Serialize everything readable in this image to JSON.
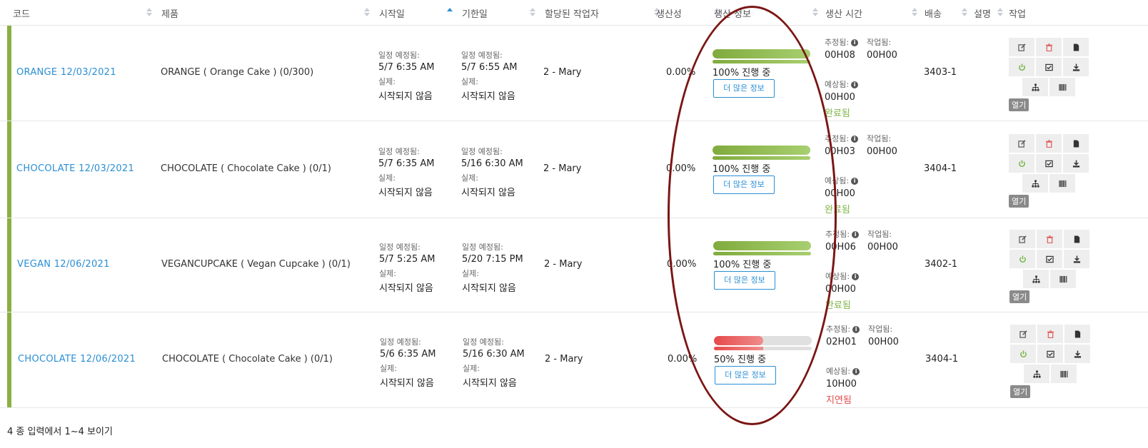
{
  "columns": [
    {
      "key": "code",
      "label": "코드"
    },
    {
      "key": "product",
      "label": "제품"
    },
    {
      "key": "start",
      "label": "시작일"
    },
    {
      "key": "due",
      "label": "기한일"
    },
    {
      "key": "assignee",
      "label": "할당된 작업자"
    },
    {
      "key": "productivity",
      "label": "생산성"
    },
    {
      "key": "prod_info",
      "label": "생산 정보"
    },
    {
      "key": "prod_time",
      "label": "생산 시간"
    },
    {
      "key": "shipping",
      "label": "배송"
    },
    {
      "key": "desc",
      "label": "설명"
    },
    {
      "key": "actions",
      "label": "작업"
    }
  ],
  "labels": {
    "scheduled": "일정 예정됨:",
    "actual": "실제:",
    "not_started": "시작되지 않음",
    "estimated": "추정됨:",
    "worked": "작업됨:",
    "expected": "예상됨:",
    "more_info": "더 많은 정보",
    "open": "열기",
    "info_glyph": "i"
  },
  "rows": [
    {
      "code": "ORANGE 12/03/2021",
      "product": "ORANGE ( Orange Cake ) (0/300)",
      "start_sched": "5/7   6:35 AM",
      "due_sched": "5/7   6:55 AM",
      "assignee": "2 - Mary",
      "productivity": "0.00%",
      "progress": 1.0,
      "progress_text": "100% 진행 중",
      "bar_color": "green",
      "estimated": "00H08",
      "worked": "00H00",
      "expected": "00H00",
      "status": "완료됨",
      "status_color": "green",
      "shipping": "3403-1"
    },
    {
      "code": "CHOCOLATE 12/03/2021",
      "product": "CHOCOLATE ( Chocolate Cake ) (0/1)",
      "start_sched": "5/7   6:35 AM",
      "due_sched": "5/16   6:30 AM",
      "assignee": "2 - Mary",
      "productivity": "0.00%",
      "progress": 1.0,
      "progress_text": "100% 진행 중",
      "bar_color": "green",
      "estimated": "00H03",
      "worked": "00H00",
      "expected": "00H00",
      "status": "완료됨",
      "status_color": "green",
      "shipping": "3404-1"
    },
    {
      "code": "VEGAN 12/06/2021",
      "product": "VEGANCUPCAKE ( Vegan Cupcake ) (0/1)",
      "start_sched": "5/7   5:25 AM",
      "due_sched": "5/20   7:15 PM",
      "assignee": "2 - Mary",
      "productivity": "0.00%",
      "progress": 1.0,
      "progress_text": "100% 진행 중",
      "bar_color": "green",
      "estimated": "00H06",
      "worked": "00H00",
      "expected": "00H00",
      "status": "완료됨",
      "status_color": "green",
      "shipping": "3402-1"
    },
    {
      "code": "CHOCOLATE 12/06/2021",
      "product": "CHOCOLATE ( Chocolate Cake ) (0/1)",
      "start_sched": "5/6   6:35 AM",
      "due_sched": "5/16   6:30 AM",
      "assignee": "2 - Mary",
      "productivity": "0.00%",
      "progress": 0.5,
      "progress_text": "50% 진행 중",
      "bar_color": "red",
      "estimated": "02H01",
      "worked": "00H00",
      "expected": "10H00",
      "status": "지연됨",
      "status_color": "red",
      "shipping": "3404-1"
    }
  ],
  "action_icons": [
    {
      "name": "edit-icon",
      "color": "#555"
    },
    {
      "name": "trash-icon",
      "color": "#e05a5a"
    },
    {
      "name": "document-icon",
      "color": "#333"
    },
    {
      "name": "power-icon",
      "color": "#6bb33a"
    },
    {
      "name": "checklist-icon",
      "color": "#333"
    },
    {
      "name": "download-icon",
      "color": "#333"
    },
    {
      "name": "hierarchy-icon",
      "color": "#333"
    },
    {
      "name": "barcode-icon",
      "color": "#333"
    }
  ],
  "footer": "4 종 입력에서 1~4 보이기",
  "colors": {
    "accent_green": "#8ab043",
    "link_blue": "#2a8fd4",
    "status_green": "#7eb344",
    "status_red": "#e14d4d",
    "annotation_oval": "#7a1614"
  }
}
